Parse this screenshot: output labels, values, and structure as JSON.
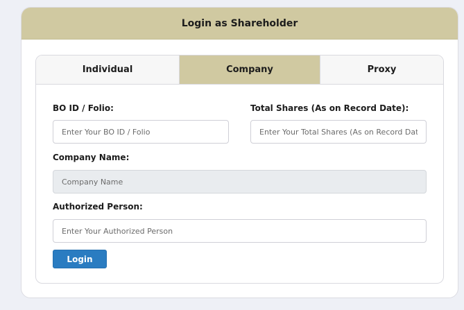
{
  "header": {
    "title": "Login as Shareholder"
  },
  "tabs": [
    {
      "label": "Individual",
      "active": false
    },
    {
      "label": "Company",
      "active": true
    },
    {
      "label": "Proxy",
      "active": false
    }
  ],
  "form": {
    "bo_id": {
      "label": "BO ID / Folio:",
      "placeholder": "Enter Your BO ID / Folio",
      "value": ""
    },
    "total_shares": {
      "label": "Total Shares (As on Record Date):",
      "placeholder": "Enter Your Total Shares (As on Record Date)",
      "value": ""
    },
    "company_name": {
      "label": "Company Name:",
      "placeholder": "Company Name",
      "value": "",
      "disabled": true
    },
    "authorized_person": {
      "label": "Authorized Person:",
      "placeholder": "Enter Your Authorized Person",
      "value": ""
    },
    "submit_label": "Login"
  },
  "colors": {
    "header_bg": "#d0c9a1",
    "active_tab_bg": "#d0c9a1",
    "button_bg": "#2a7cc1",
    "page_bg": "#eef0f6"
  }
}
